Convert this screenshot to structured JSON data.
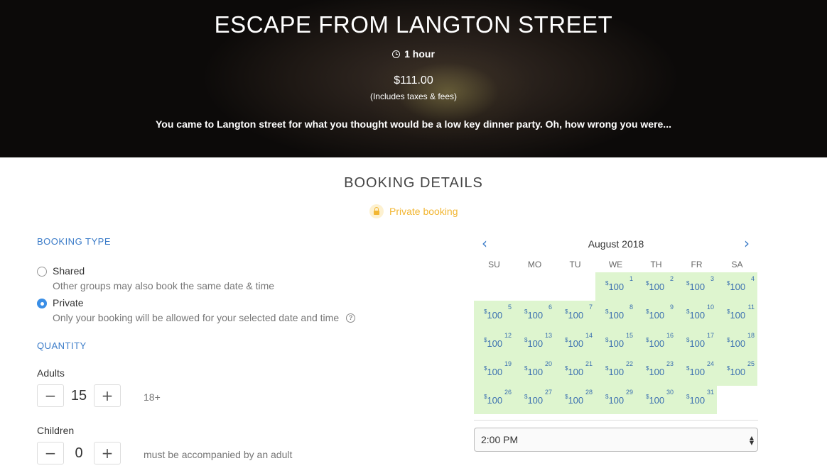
{
  "hero": {
    "title": "ESCAPE FROM LANGTON STREET",
    "duration": "1 hour",
    "price": "$111.00",
    "taxes_note": "(Includes taxes & fees)",
    "description": "You came to Langton street for what you thought would be a low key dinner party. Oh, how wrong you were..."
  },
  "booking": {
    "title": "BOOKING DETAILS",
    "private_badge": "Private booking"
  },
  "booking_type": {
    "label": "BOOKING TYPE",
    "options": [
      {
        "label": "Shared",
        "description": "Other groups may also book the same date & time",
        "selected": false
      },
      {
        "label": "Private",
        "description": "Only your booking will be allowed for your selected date and time",
        "selected": true
      }
    ]
  },
  "quantity": {
    "label": "QUANTITY",
    "adults": {
      "label": "Adults",
      "value": "15",
      "note": "18+",
      "minus": "−",
      "plus": "+"
    },
    "children": {
      "label": "Children",
      "value": "0",
      "note": "must be accompanied by an adult",
      "minus": "−",
      "plus": "+"
    }
  },
  "calendar": {
    "month": "August 2018",
    "prev": "‹",
    "next": "›",
    "weekdays": [
      "SU",
      "MO",
      "TU",
      "WE",
      "TH",
      "FR",
      "SA"
    ],
    "first_weekday_index": 3,
    "days_in_month": 31,
    "price_symbol": "$",
    "price_value": "100"
  },
  "time_select": {
    "value": "2:00 PM"
  },
  "colors": {
    "accent": "#3a7bc8",
    "available_day": "#def5cf",
    "private_badge": "#f2b632",
    "radio_selected": "#3a8ee6"
  }
}
